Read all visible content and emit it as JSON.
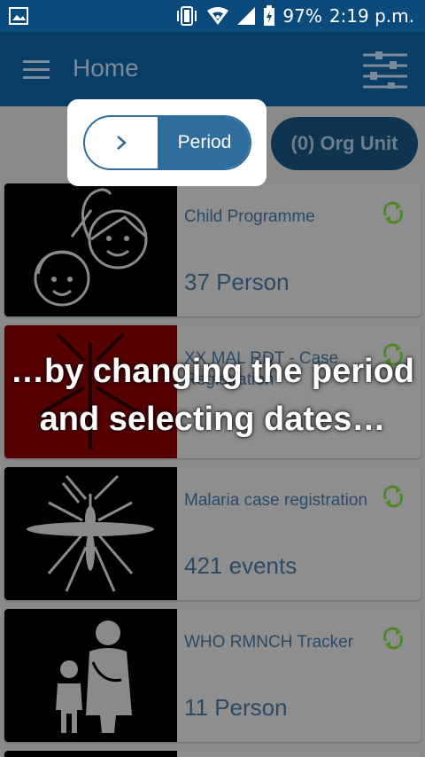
{
  "status_bar": {
    "battery": "97%",
    "time": "2:19 p.m.",
    "icons": [
      "image-icon",
      "vibrate-icon",
      "wifi-icon",
      "signal-icon",
      "battery-icon"
    ]
  },
  "toolbar": {
    "title": "Home",
    "icons": [
      "menu-icon",
      "filter-icon"
    ]
  },
  "filters": {
    "period_label": "Period",
    "org_unit_label": "(0) Org Unit"
  },
  "programs": [
    {
      "name": "Child Programme",
      "count": "37 Person",
      "icon": "children-icon"
    },
    {
      "name": "XX MAL RDT - Case Registration",
      "count": "",
      "icon": "mosquito-icon"
    },
    {
      "name": "Malaria case registration",
      "count": "421 events",
      "icon": "mosquito-icon"
    },
    {
      "name": "WHO RMNCH Tracker",
      "count": "11 Person",
      "icon": "family-icon"
    }
  ],
  "overlay": {
    "line1": "…by changing the period",
    "line2": "and selecting dates…"
  },
  "colors": {
    "status_bar": "#0a4a7c",
    "toolbar": "#083e66",
    "accent": "#2f6d9c",
    "sync": "#4f8a2a"
  }
}
